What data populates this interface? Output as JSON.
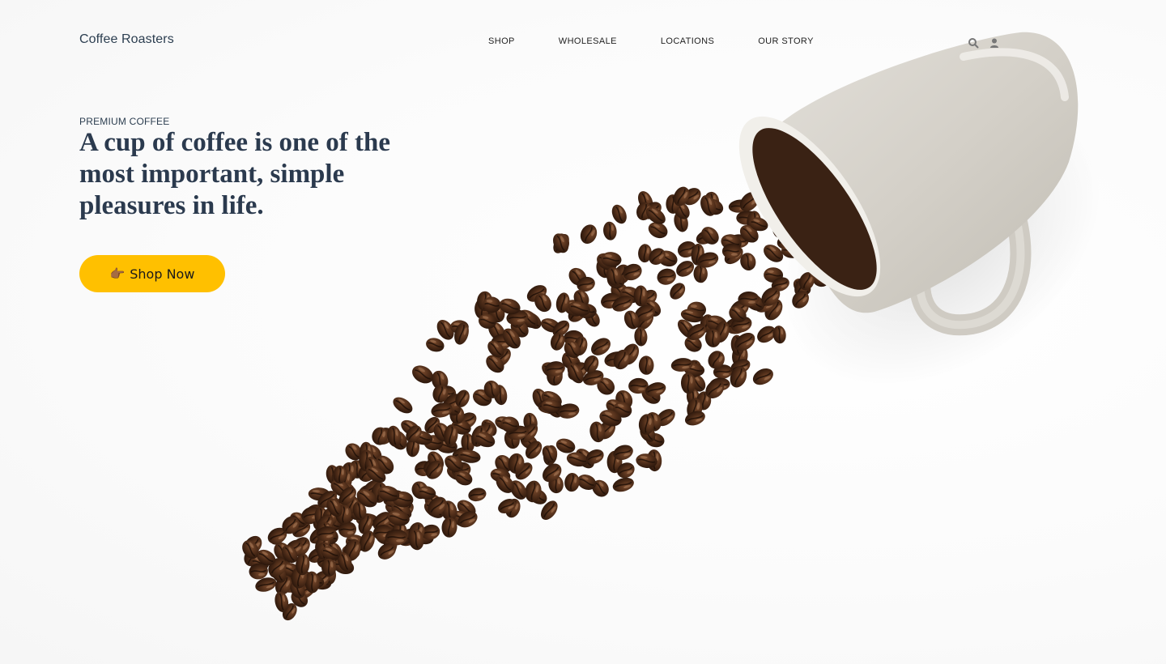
{
  "header": {
    "brand": "Coffee Roasters",
    "nav": [
      {
        "label": "SHOP"
      },
      {
        "label": "WHOLESALE"
      },
      {
        "label": "LOCATIONS"
      },
      {
        "label": "OUR STORY"
      }
    ],
    "icons": [
      "search-icon",
      "user-icon"
    ]
  },
  "hero": {
    "eyebrow": "PREMIUM COFFEE",
    "headline": "A cup of coffee is one of the most important, simple pleasures in life.",
    "cta": {
      "icon": "👉🏾",
      "label": "Shop Now"
    }
  },
  "colors": {
    "accent": "#ffc000",
    "heading": "#2b3a4e",
    "mug": "#d6d3cc",
    "bean": "#4a2a17"
  }
}
